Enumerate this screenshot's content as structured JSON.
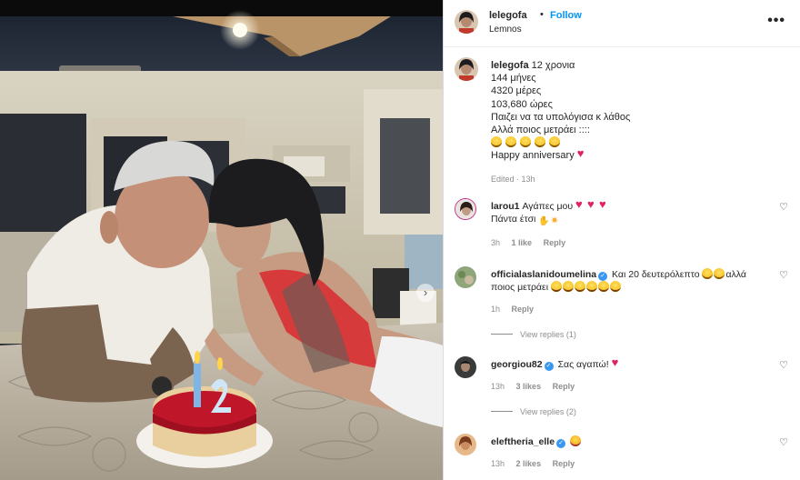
{
  "post": {
    "username": "lelegofa",
    "separator": "•",
    "follow_label": "Follow",
    "location": "Lemnos",
    "more_icon": "more-horizontal-icon"
  },
  "caption": {
    "username": "lelegofa",
    "lines": [
      "12 χρονια",
      "144 μήνες",
      "4320 μέρες",
      "103,680 ώρες",
      "Παιζει να τα υπολόγισα κ λάθος",
      "Αλλά ποιος μετράει ::::",
      "",
      "Happy anniversary"
    ],
    "meta": "Edited · 13h"
  },
  "comments": [
    {
      "username": "larou1",
      "text": "Αγάπες μου",
      "text2": "Πάντα έτσι",
      "time": "3h",
      "likes": "1 like",
      "reply": "Reply"
    },
    {
      "username": "officialaslanidoumelina",
      "text": "Και 20 δευτερόλεπτο",
      "text_after": "αλλά",
      "text2": "ποιος μετράει",
      "time": "1h",
      "reply": "Reply",
      "view_replies": "View replies (1)"
    },
    {
      "username": "georgiou82",
      "text": "Σας αγαπώ!",
      "time": "13h",
      "likes": "3 likes",
      "reply": "Reply",
      "view_replies": "View replies (2)"
    },
    {
      "username": "eleftheria_elle",
      "text": "",
      "time": "13h",
      "likes": "2 likes",
      "reply": "Reply"
    }
  ],
  "colors": {
    "accent": "#0095f6",
    "verified": "#3897f0",
    "muted": "#8e8e8e",
    "heart": "#e0245e"
  },
  "icons": {
    "heart_outline": "♡",
    "verified_check": "✓",
    "carousel_next": "›"
  }
}
